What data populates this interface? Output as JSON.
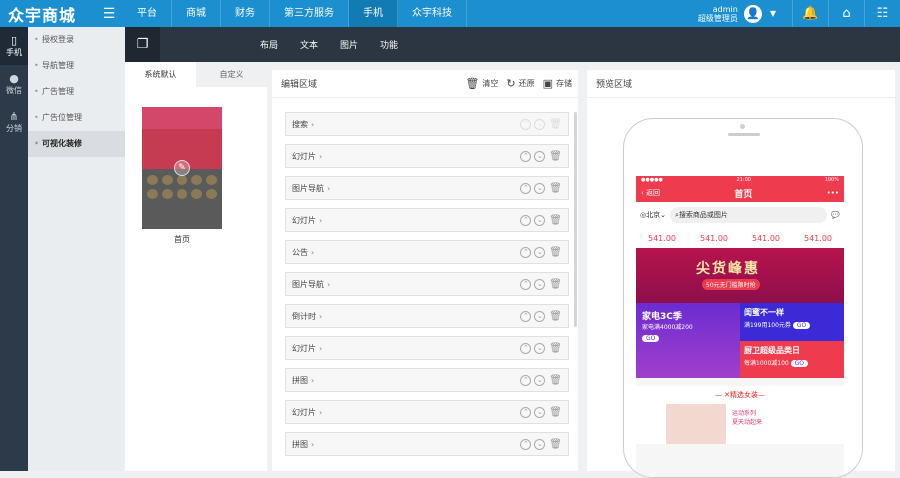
{
  "logo": "众宇商城",
  "nav": [
    "平台",
    "商城",
    "财务",
    "第三方服务",
    "手机",
    "众宇科技"
  ],
  "nav_active": 4,
  "user": {
    "name": "admin",
    "role": "超级管理员"
  },
  "left_rail": [
    {
      "label": "手机",
      "icon": "phone-icon"
    },
    {
      "label": "微信",
      "icon": "wechat-icon"
    },
    {
      "label": "分销",
      "icon": "distribution-icon"
    }
  ],
  "subnav": [
    "授权登录",
    "导航管理",
    "广告管理",
    "广告位管理",
    "可视化装修"
  ],
  "subnav_active": 4,
  "toolbar": [
    "布局",
    "文本",
    "图片",
    "功能"
  ],
  "tpl_tabs": [
    "系统默认",
    "自定义"
  ],
  "template_caption": "首页",
  "edit": {
    "title": "编辑区域",
    "clear": "清空",
    "restore": "还原",
    "save": "存储",
    "modules": [
      "搜索",
      "幻灯片",
      "图片导航",
      "幻灯片",
      "公告",
      "图片导航",
      "倒计时",
      "幻灯片",
      "拼图",
      "幻灯片",
      "拼图"
    ]
  },
  "preview": {
    "title": "预览区域",
    "status_time": "21:00",
    "status_battery": "100%",
    "back": "返回",
    "page_title": "首页",
    "city": "北京",
    "search_placeholder": "搜索商品或图片",
    "prices": [
      "541.00",
      "541.00",
      "541.00",
      "541.00"
    ],
    "flash_title": "尖货峰惠",
    "flash_sub": "50元无门槛限时抢",
    "promo_left_title": "家电3C季",
    "promo_left_sub": "家电满4000减200",
    "promo_right1_title": "闺蜜不一样",
    "promo_right1_sub": "满199用100元券",
    "promo_right2_title": "厨卫超级品类日",
    "promo_right2_sub": "每满1000减100",
    "go": "GO",
    "section": "精选女装",
    "fashion_title": "运动系列",
    "fashion_sub": "夏天动起来"
  }
}
